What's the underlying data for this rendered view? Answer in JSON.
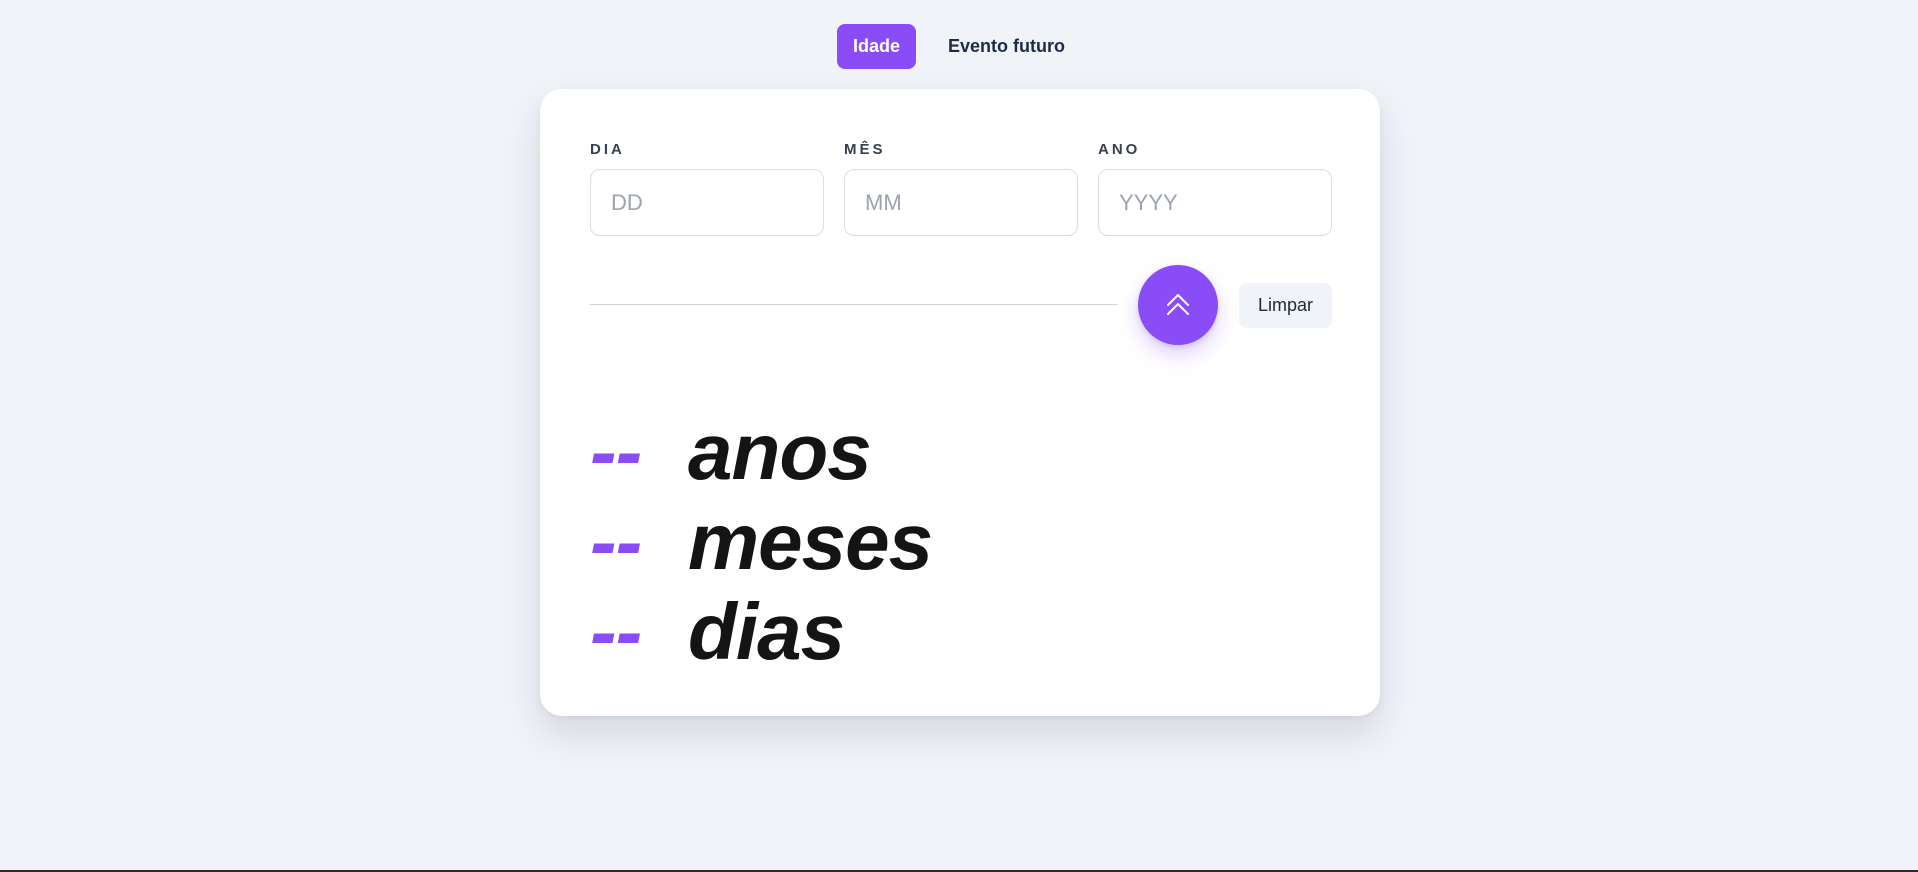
{
  "tabs": [
    {
      "label": "Idade",
      "active": true
    },
    {
      "label": "Evento futuro",
      "active": false
    }
  ],
  "form": {
    "day": {
      "label": "DIA",
      "placeholder": "DD",
      "value": ""
    },
    "month": {
      "label": "MÊS",
      "placeholder": "MM",
      "value": ""
    },
    "year": {
      "label": "ANO",
      "placeholder": "YYYY",
      "value": ""
    }
  },
  "actions": {
    "submit_icon": "double-chevron-up-icon",
    "clear_label": "Limpar"
  },
  "results": [
    {
      "value": "--",
      "unit": "anos"
    },
    {
      "value": "--",
      "unit": "meses"
    },
    {
      "value": "--",
      "unit": "dias"
    }
  ],
  "colors": {
    "accent": "#8a4cf6",
    "background": "#f0f3f8",
    "card": "#ffffff",
    "text_dark": "#141414"
  }
}
